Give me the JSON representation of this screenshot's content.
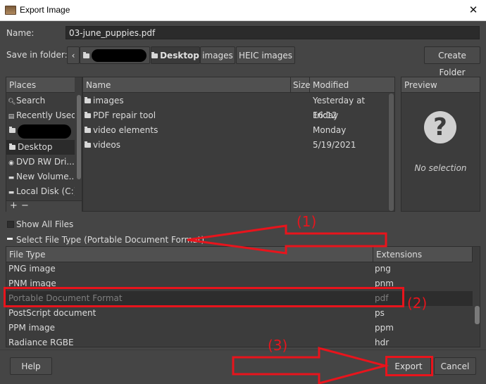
{
  "window": {
    "title": "Export Image"
  },
  "name_label": "Name:",
  "name_value": "03-june_puppies.pdf",
  "save_in_label": "Save in folder:",
  "path_segments": [
    "Desktop",
    "images",
    "HEIC images"
  ],
  "create_folder": "Create Folder",
  "places": {
    "header": "Places",
    "items": [
      {
        "label": "Search",
        "icon": "search-icon"
      },
      {
        "label": "Recently Used",
        "icon": "recent-icon"
      },
      {
        "label": "",
        "icon": "folder-icon",
        "redacted": true
      },
      {
        "label": "Desktop",
        "icon": "folder-icon"
      },
      {
        "label": "DVD RW Dri...",
        "icon": "disc-icon"
      },
      {
        "label": "New Volume...",
        "icon": "drive-icon"
      },
      {
        "label": "Local Disk (C:)",
        "icon": "drive-icon"
      }
    ],
    "add": "+",
    "remove": "−"
  },
  "files": {
    "headers": {
      "name": "Name",
      "size": "Size",
      "modified": "Modified"
    },
    "rows": [
      {
        "name": "images",
        "modified": "Yesterday at 16:12"
      },
      {
        "name": "PDF repair tool",
        "modified": "Friday"
      },
      {
        "name": "video elements",
        "modified": "Monday"
      },
      {
        "name": "videos",
        "modified": "5/19/2021"
      }
    ]
  },
  "preview": {
    "header": "Preview",
    "empty_text": "No selection"
  },
  "show_all_files": "Show All Files",
  "select_file_type": "Select File Type (Portable Document Format)",
  "file_types": {
    "headers": {
      "type": "File Type",
      "extensions": "Extensions"
    },
    "rows": [
      {
        "type": "PNG image",
        "ext": "png"
      },
      {
        "type": "PNM image",
        "ext": "pnm"
      },
      {
        "type": "Portable Document Format",
        "ext": "pdf",
        "selected": true
      },
      {
        "type": "PostScript document",
        "ext": "ps"
      },
      {
        "type": "PPM image",
        "ext": "ppm"
      },
      {
        "type": "Radiance RGBE",
        "ext": "hdr"
      }
    ]
  },
  "buttons": {
    "help": "Help",
    "export": "Export",
    "cancel": "Cancel"
  },
  "annotations": {
    "step1": "(1)",
    "step2": "(2)",
    "step3": "(3)",
    "color": "#e8141c"
  }
}
